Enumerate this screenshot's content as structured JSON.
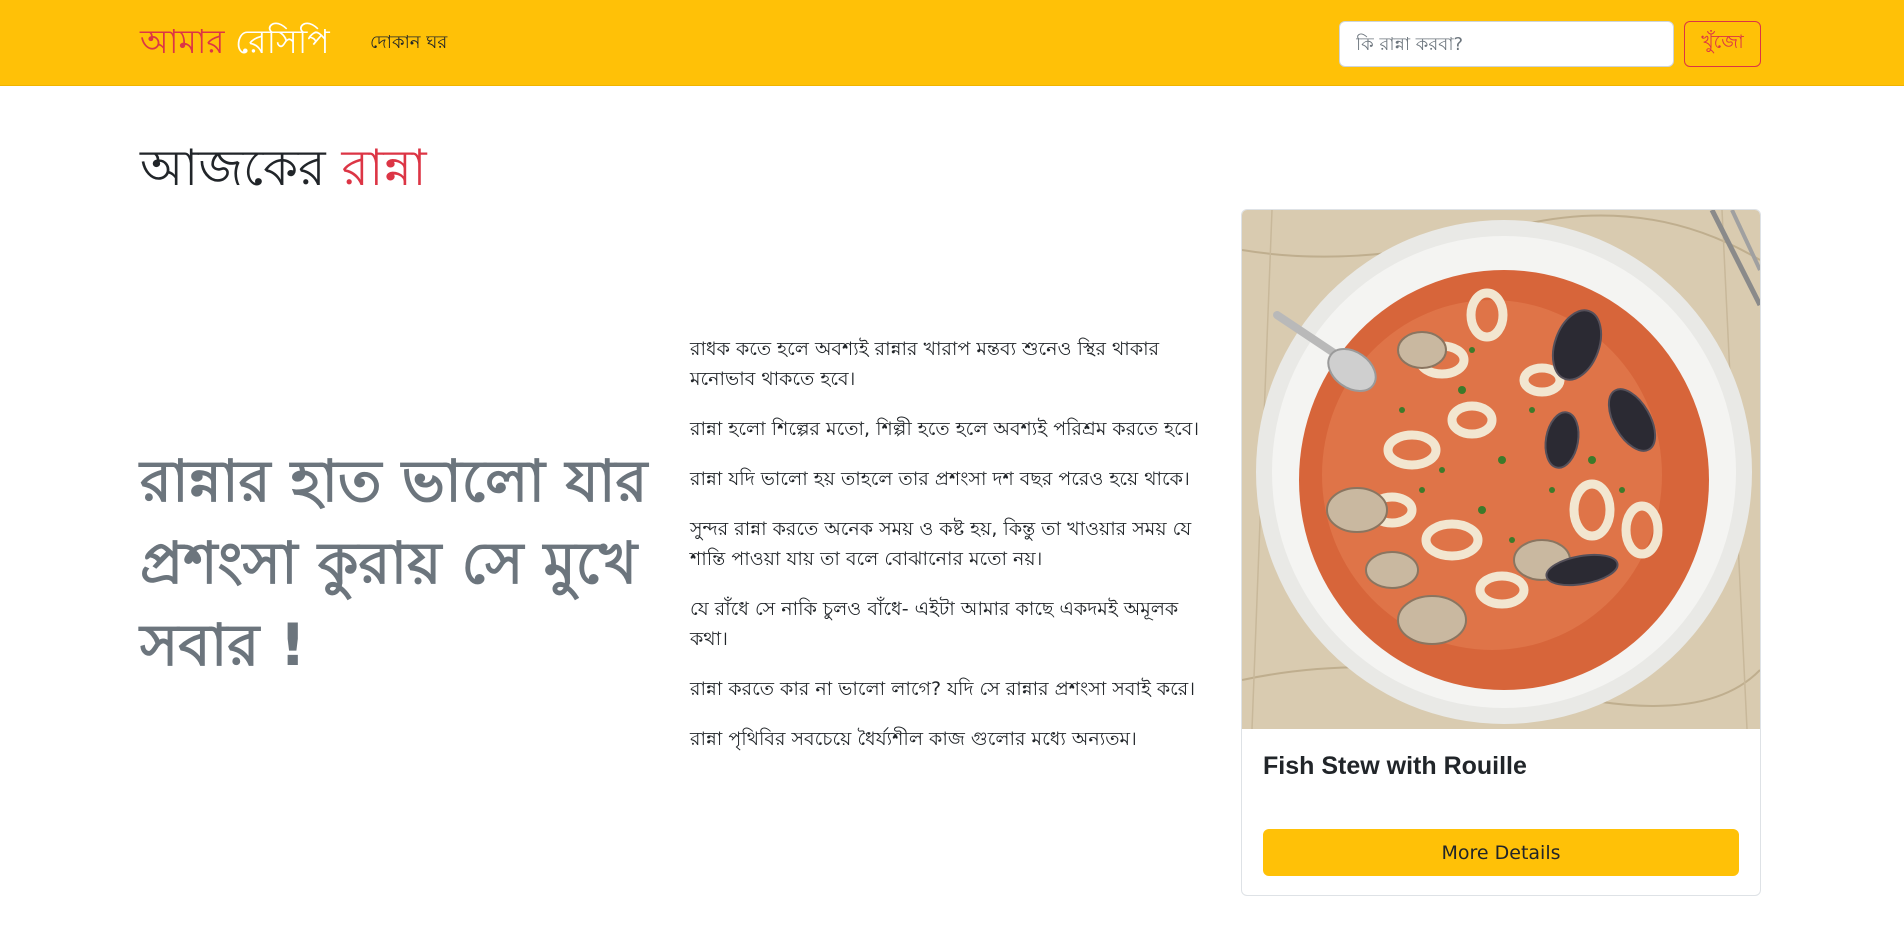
{
  "navbar": {
    "brand_part1": "আমার",
    "brand_part2": "রেসিপি",
    "shop_link": "দোকান ঘর",
    "search_placeholder": "কি রান্না করবা?",
    "search_button": "খুঁজো",
    "colors": {
      "background": "#ffc107",
      "accent": "#dc3545"
    }
  },
  "page": {
    "title_part1": "আজকের",
    "title_part2": "রান্না",
    "slogan": "রান্নার হাত ভালো যার প্রশংসা কুরায় সে মুখে সবার !"
  },
  "quotes": [
    "রাধক কতে হলে অবশ্যই রান্নার খারাপ মন্তব্য শুনেও স্থির থাকার মনোভাব থাকতে হবে।",
    "রান্না হলো শিল্পের মতো, শিল্পী হতে হলে অবশ্যই পরিশ্রম করতে হবে।",
    "রান্না যদি ভালো হয় তাহলে তার প্রশংসা দশ বছর পরেও হয়ে থাকে।",
    "সুন্দর রান্না করতে অনেক সময় ও কষ্ট হয়, কিন্তু তা খাওয়ার সময় যে শান্তি পাওয়া যায় তা বলে বোঝানোর মতো নয়।",
    "যে রাঁধে সে নাকি চুলও বাঁধে- এইটা আমার কাছে একদমই অমূলক কথা।",
    "রান্না করতে কার না ভালো লাগে? যদি সে রান্নার প্রশংসা সবাই করে।",
    "রান্না পৃথিবির সবচেয়ে ধৈর্য্যশীল কাজ গুলোর মধ্যে অন্যতম।"
  ],
  "card": {
    "title": "Fish Stew with Rouille",
    "button": "More Details"
  }
}
